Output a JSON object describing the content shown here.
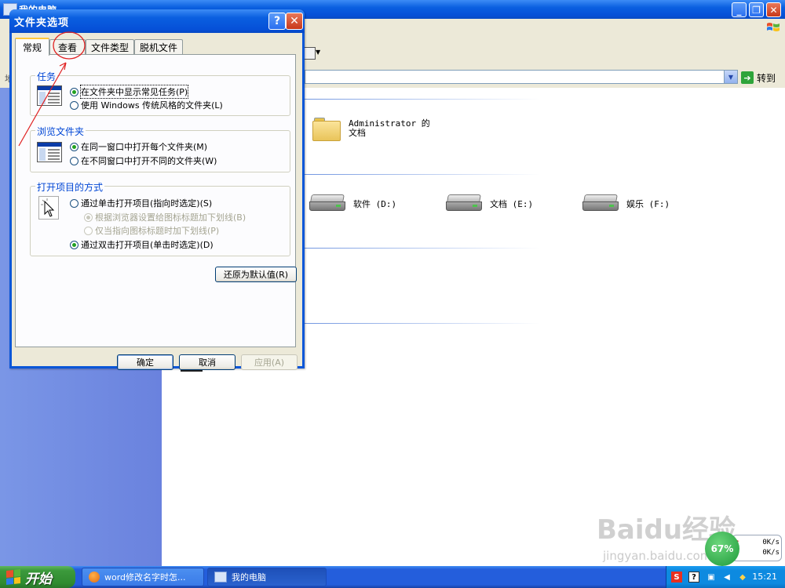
{
  "explorer": {
    "title": "我的电脑",
    "address_label": "地",
    "go_label": "转到",
    "items": [
      {
        "name": "Administrator 的文档",
        "type": "folder"
      },
      {
        "name": "软件 (D:)",
        "type": "drive"
      },
      {
        "name": "文档 (E:)",
        "type": "drive"
      },
      {
        "name": "娱乐 (F:)",
        "type": "drive"
      }
    ]
  },
  "dialog": {
    "title": "文件夹选项",
    "tabs": [
      "常规",
      "查看",
      "文件类型",
      "脱机文件"
    ],
    "active_tab": "常规",
    "groups": {
      "tasks": {
        "title": "任务",
        "options": [
          {
            "label": "在文件夹中显示常见任务(P)",
            "checked": true
          },
          {
            "label": "使用 Windows 传统风格的文件夹(L)",
            "checked": false
          }
        ]
      },
      "browse": {
        "title": "浏览文件夹",
        "options": [
          {
            "label": "在同一窗口中打开每个文件夹(M)",
            "checked": true
          },
          {
            "label": "在不同窗口中打开不同的文件夹(W)",
            "checked": false
          }
        ]
      },
      "open": {
        "title": "打开项目的方式",
        "options": [
          {
            "label": "通过单击打开项目(指向时选定)(S)",
            "checked": false
          },
          {
            "label": "根据浏览器设置给图标标题加下划线(B)",
            "checked": true,
            "disabled": true
          },
          {
            "label": "仅当指向图标标题时加下划线(P)",
            "checked": false,
            "disabled": true
          },
          {
            "label": "通过双击打开项目(单击时选定)(D)",
            "checked": true
          }
        ]
      }
    },
    "restore_defaults": "还原为默认值(R)",
    "buttons": {
      "ok": "确定",
      "cancel": "取消",
      "apply": "应用(A)"
    }
  },
  "taskbar": {
    "start_label": "开始",
    "items": [
      {
        "label": "word修改名字时怎..."
      },
      {
        "label": "我的电脑"
      }
    ],
    "clock": "15:21",
    "tray_icons": [
      "s-icon",
      "help-icon",
      "network-icon",
      "speaker-icon",
      "security-icon"
    ]
  },
  "net_monitor": {
    "percent": "67%",
    "up": "0K/s",
    "down": "0K/s"
  },
  "watermark": {
    "brand": "Baidu经验",
    "url": "jingyan.baidu.com"
  }
}
